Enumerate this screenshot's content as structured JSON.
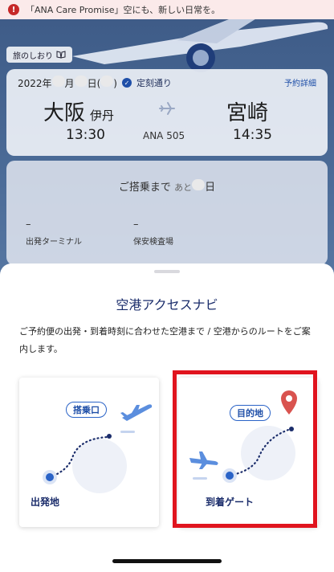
{
  "banner": {
    "text": "「ANA Care Promise」空にも、新しい日常を。",
    "icon": "warning-icon",
    "color": "#c62828"
  },
  "guide_tag": {
    "label": "旅のしおり",
    "icon": "book-icon"
  },
  "flight_card": {
    "date_prefix": "2022年",
    "date_month_suffix": "月",
    "date_day_suffix": "日(",
    "date_close": ")",
    "status": "定刻通り",
    "detail_link": "予約詳細",
    "origin_city": "大阪",
    "origin_airport": "伊丹",
    "destination_city": "宮崎",
    "departure_time": "13:30",
    "arrival_time": "14:35",
    "flight_number": "ANA 505"
  },
  "boarding_card": {
    "title_prefix": "ご搭乗まで",
    "title_mid": "あと",
    "title_suffix": "日",
    "terminal_value": "–",
    "terminal_label": "出発ターミナル",
    "security_value": "–",
    "security_label": "保安検査場"
  },
  "sheet": {
    "title": "空港アクセスナビ",
    "description": "ご予約便の出発・到着時刻に合わせた空港まで / 空港からのルートをご案内します。",
    "options": [
      {
        "pill": "搭乗口",
        "label": "出発地"
      },
      {
        "pill": "目的地",
        "label": "到着ゲート"
      }
    ]
  },
  "colors": {
    "accent": "#1f4fa8",
    "highlight": "#e0141e",
    "pin": "#d9534f"
  }
}
